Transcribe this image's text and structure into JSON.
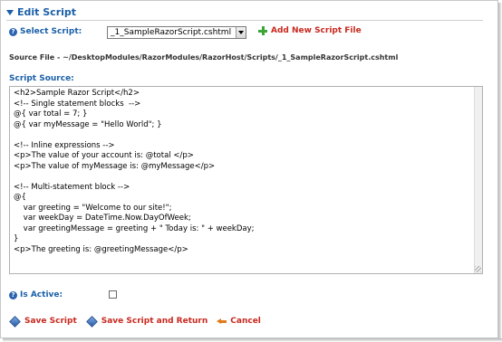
{
  "section": {
    "title": "Edit Script"
  },
  "select_script": {
    "label": "Select Script:",
    "value": "_1_SampleRazorScript.cshtml"
  },
  "add_new": {
    "label": "Add New Script File"
  },
  "source_file": {
    "text": "Source File - ~/DesktopModules/RazorModules/RazorHost/Scripts/_1_SampleRazorScript.cshtml"
  },
  "script_source": {
    "label": "Script Source:",
    "code": "<h2>Sample Razor Script</h2>\n<!-- Single statement blocks  -->\n@{ var total = 7; }\n@{ var myMessage = \"Hello World\"; }\n\n<!-- Inline expressions -->\n<p>The value of your account is: @total </p>\n<p>The value of myMessage is: @myMessage</p>\n\n<!-- Multi-statement block -->\n@{\n    var greeting = \"Welcome to our site!\";\n    var weekDay = DateTime.Now.DayOfWeek;\n    var greetingMessage = greeting + \" Today is: \" + weekDay;\n}\n<p>The greeting is: @greetingMessage</p>"
  },
  "is_active": {
    "label": "Is Active:",
    "checked": false
  },
  "actions": {
    "save": "Save Script",
    "save_return": "Save Script and Return",
    "cancel": "Cancel"
  },
  "colors": {
    "link_red": "#c8281e",
    "label_blue": "#1a5fa8",
    "add_green": "#3aa635"
  }
}
